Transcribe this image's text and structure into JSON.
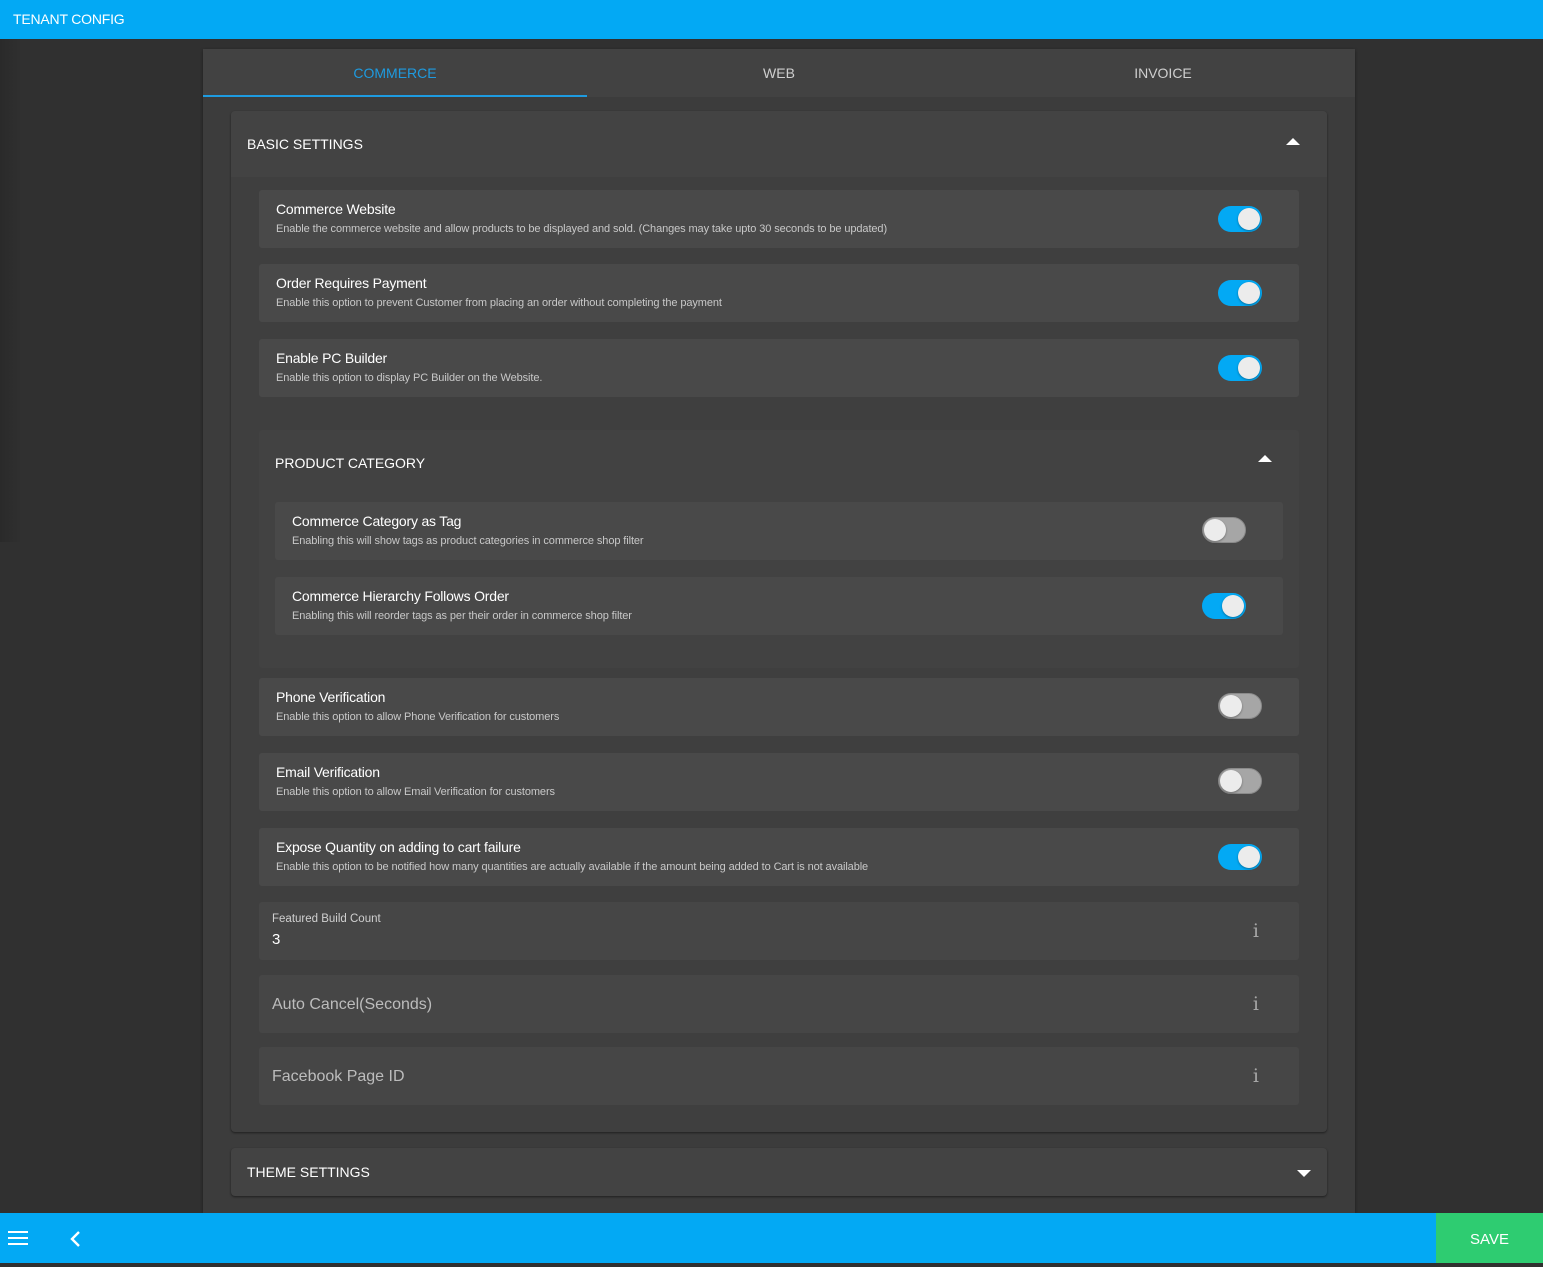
{
  "app": {
    "title": "TENANT CONFIG"
  },
  "tabs": [
    {
      "label": "COMMERCE",
      "active": true
    },
    {
      "label": "WEB",
      "active": false
    },
    {
      "label": "INVOICE",
      "active": false
    }
  ],
  "basic_settings": {
    "title": "BASIC SETTINGS",
    "expanded": true,
    "toggles_top": [
      {
        "label": "Commerce Website",
        "description": "Enable the commerce website and allow products to be displayed and sold. (Changes may take upto 30 seconds to be updated)",
        "enabled": true
      },
      {
        "label": "Order Requires Payment",
        "description": "Enable this option to prevent Customer from placing an order without completing the payment",
        "enabled": true
      },
      {
        "label": "Enable PC Builder",
        "description": "Enable this option to display PC Builder on the Website.",
        "enabled": true
      }
    ],
    "product_category": {
      "title": "PRODUCT CATEGORY",
      "expanded": true,
      "toggles": [
        {
          "label": "Commerce Category as Tag",
          "description": "Enabling this will show tags as product categories in commerce shop filter",
          "enabled": false
        },
        {
          "label": "Commerce Hierarchy Follows Order",
          "description": "Enabling this will reorder tags as per their order in commerce shop filter",
          "enabled": true
        }
      ]
    },
    "toggles_bottom": [
      {
        "label": "Phone Verification",
        "description": "Enable this option to allow Phone Verification for customers",
        "enabled": false
      },
      {
        "label": "Email Verification",
        "description": "Enable this option to allow Email Verification for customers",
        "enabled": false
      },
      {
        "label": "Expose Quantity on adding to cart failure",
        "description": "Enable this option to be notified how many quantities are actually available if the amount being added to Cart is not available",
        "enabled": true
      }
    ],
    "fields": [
      {
        "label": "Featured Build Count",
        "value": "3",
        "info_icon": "info-icon"
      },
      {
        "label": "Auto Cancel(Seconds)",
        "value": "",
        "info_icon": "info-icon"
      },
      {
        "label": "Facebook Page ID",
        "value": "",
        "info_icon": "info-icon"
      }
    ]
  },
  "theme_settings": {
    "title": "THEME SETTINGS",
    "expanded": false
  },
  "bottom_bar": {
    "menu_icon": "hamburger-menu-icon",
    "back_icon": "chevron-left-icon",
    "save_label": "SAVE"
  },
  "colors": {
    "primary": "#03a9f4",
    "tab_active": "#1e9be0",
    "save": "#2ecc71",
    "toggle_off": "#a6a6a6"
  }
}
